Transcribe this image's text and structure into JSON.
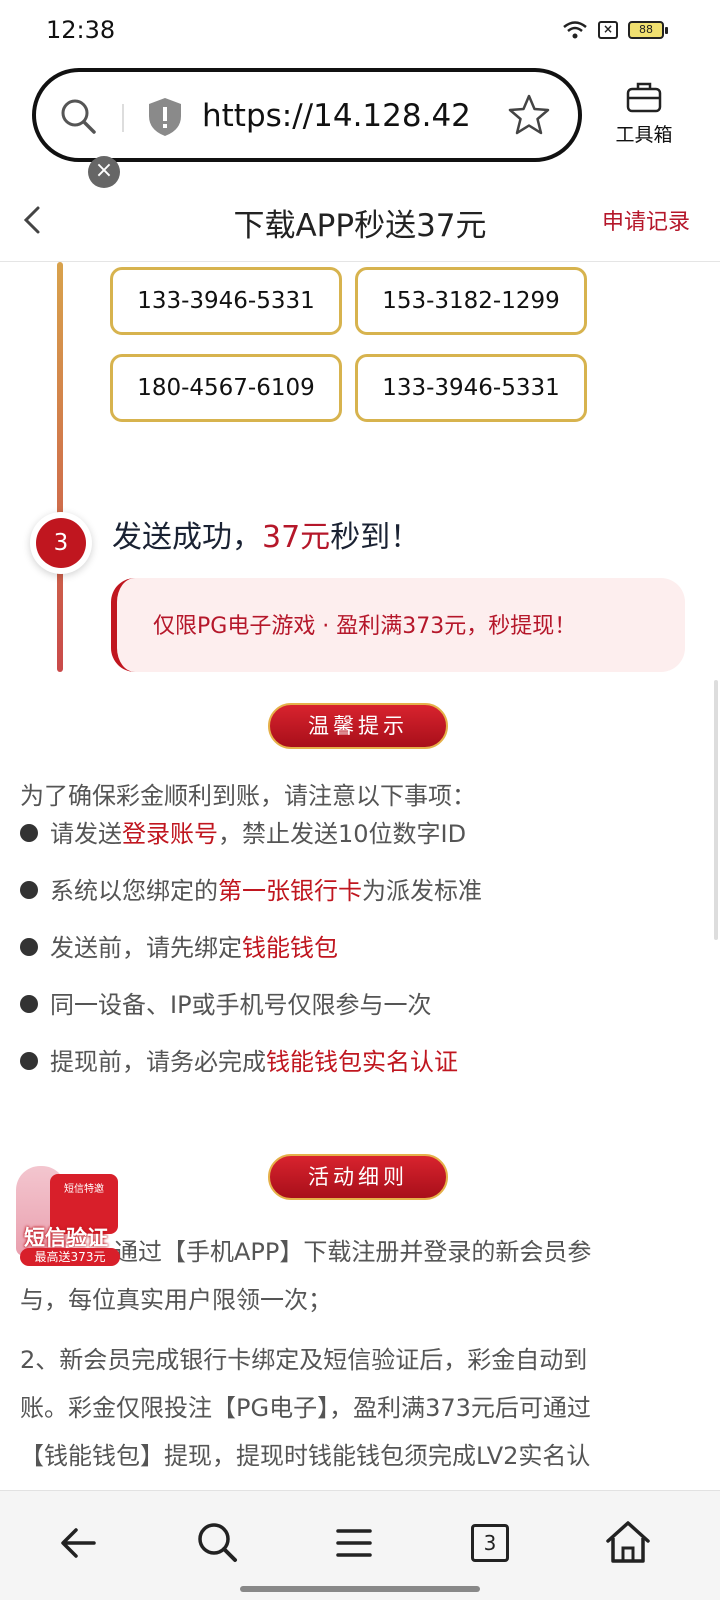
{
  "status_bar": {
    "time": "12:38",
    "battery": "88"
  },
  "browser": {
    "url": "https://14.128.42....",
    "toolbox_label": "工具箱"
  },
  "header": {
    "title": "下载APP秒送37元",
    "apply_record": "申请记录"
  },
  "phones": [
    "133-3946-5331",
    "153-3182-1299",
    "180-4567-6109",
    "133-3946-5331"
  ],
  "step": {
    "number": "3",
    "title_pre": "发送成功，",
    "title_accent": "37元",
    "title_post": "秒到！",
    "banner": "仅限PG电子游戏 · 盈利满373元，秒提现！"
  },
  "notice": {
    "label": "温馨提示",
    "intro": "为了确保彩金顺利到账，请注意以下事项：",
    "items": [
      {
        "pre": "请发送",
        "hl": "登录账号",
        "post": "，禁止发送10位数字ID"
      },
      {
        "pre": "系统以您绑定的",
        "hl": "第一张银行卡",
        "post": "为派发标准"
      },
      {
        "pre": "发送前，请先绑定",
        "hl": "钱能钱包",
        "post": ""
      },
      {
        "pre": "同一设备、IP或手机号仅限参与一次",
        "hl": "",
        "post": ""
      },
      {
        "pre": "提现前，请务必完成",
        "hl": "钱能钱包实名认证",
        "post": ""
      }
    ]
  },
  "rules": {
    "label": "活动细则",
    "p1_line1": "通过【手机APP】下载注册并登录的新会员参",
    "p1_line2": "与，每位真实用户限领一次；",
    "p2_line1": "2、新会员完成银行卡绑定及短信验证后，彩金自动到",
    "p2_line2": "账。彩金仅限投注【PG电子】，盈利满373元后可通过",
    "p2_line3": "【钱能钱包】提现，提现时钱能钱包须完成LV2实名认"
  },
  "promo": {
    "tag": "短信特邀",
    "main": "短信验证",
    "sub": "最高送373元"
  },
  "bottom_nav": {
    "tab_count": "3"
  }
}
